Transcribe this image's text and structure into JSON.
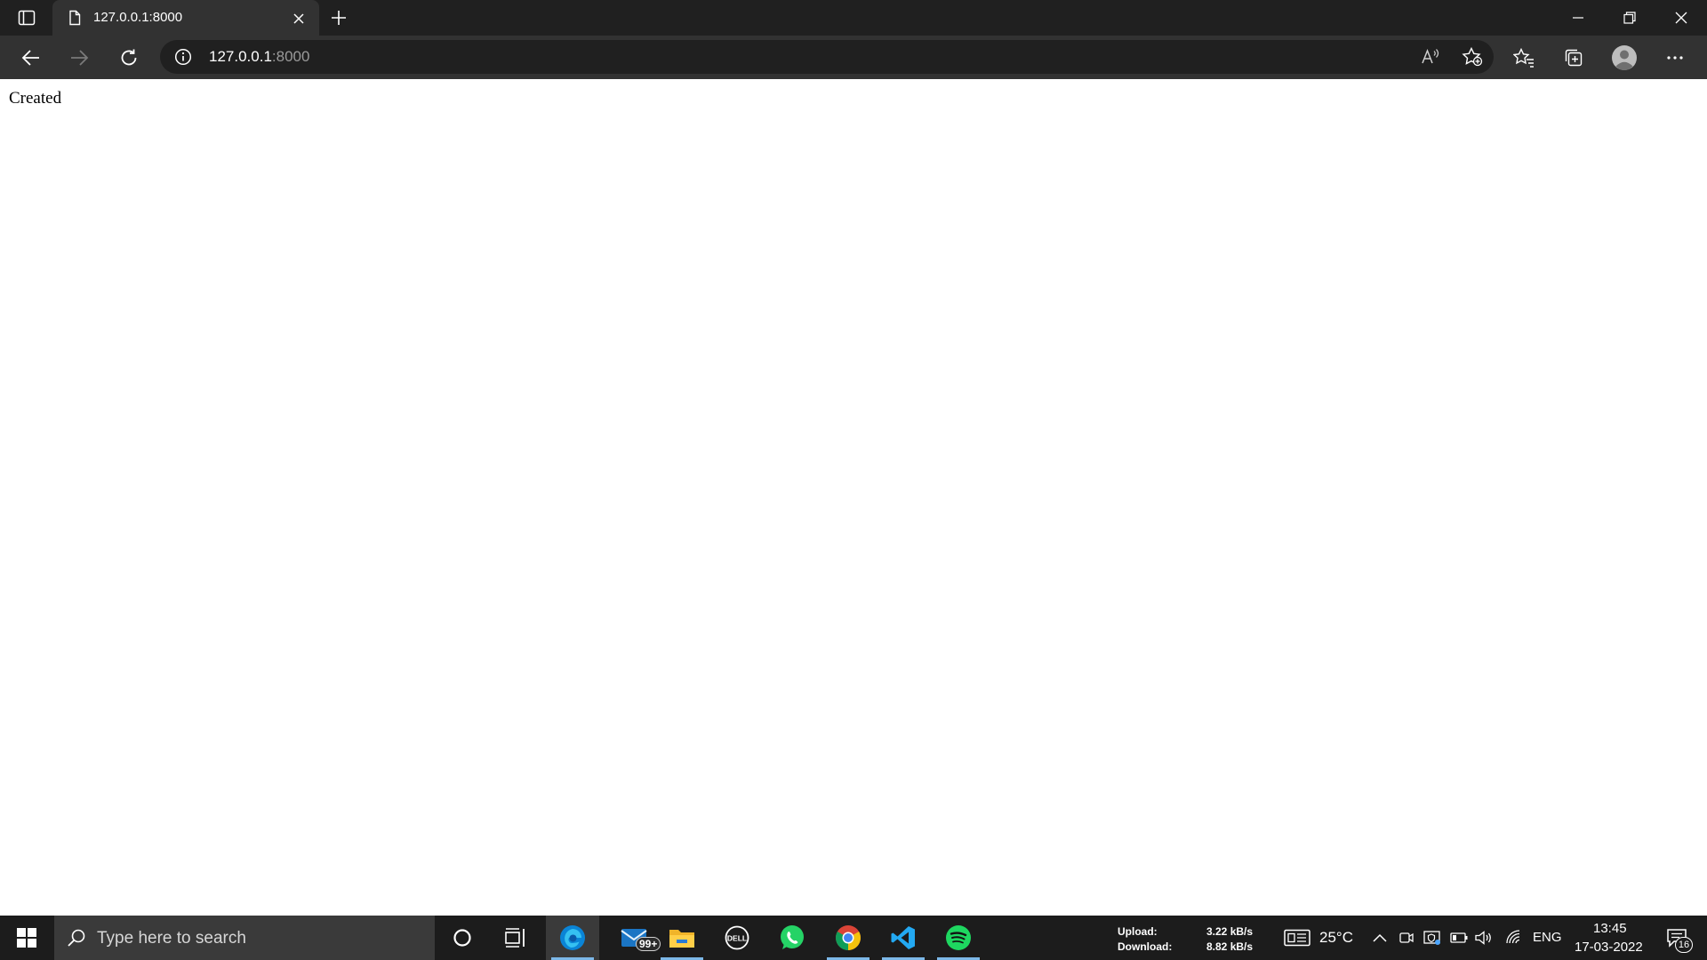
{
  "browser": {
    "tab": {
      "title": "127.0.0.1:8000"
    },
    "address": {
      "host": "127.0.0.1",
      "port": ":8000"
    }
  },
  "page": {
    "text": "Created"
  },
  "taskbar": {
    "search": {
      "placeholder": "Type here to search"
    },
    "mail_badge": "99+",
    "network": {
      "upload_label": "Upload:",
      "upload_value": "3.22 kB/s",
      "download_label": "Download:",
      "download_value": "8.82 kB/s"
    },
    "weather": {
      "temperature": "25°C"
    },
    "language": "ENG",
    "clock": {
      "time": "13:45",
      "date": "17-03-2022"
    },
    "notifications": "16"
  },
  "colors": {
    "titlebar": "#202020",
    "toolbar": "#323232",
    "taskbar": "#1c1c1c",
    "edge_accent": "#0a84d6",
    "spotify_green": "#1ed760",
    "whatsapp_green": "#25d366",
    "vscode_blue": "#23a9f2"
  }
}
